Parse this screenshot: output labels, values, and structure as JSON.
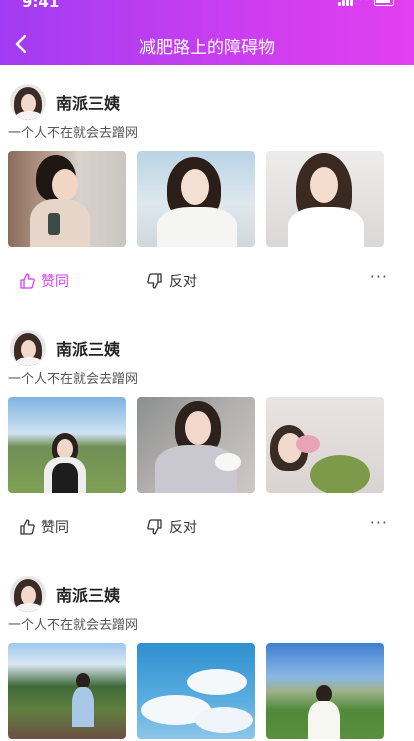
{
  "status_bar": {
    "time": "9:41"
  },
  "header": {
    "title": "减肥路上的障碍物"
  },
  "colors": {
    "accent": "#d23cf0",
    "header_gradient_start": "#a23cf2",
    "header_gradient_end": "#e23ff0"
  },
  "posts": [
    {
      "author": "南派三姨",
      "text": "一个人不在就会去蹭网",
      "like_label": "赞同",
      "dislike_label": "反对",
      "liked": true,
      "more_label": "···"
    },
    {
      "author": "南派三姨",
      "text": "一个人不在就会去蹭网",
      "like_label": "赞同",
      "dislike_label": "反对",
      "liked": false,
      "more_label": "···"
    },
    {
      "author": "南派三姨",
      "text": "一个人不在就会去蹭网"
    }
  ]
}
